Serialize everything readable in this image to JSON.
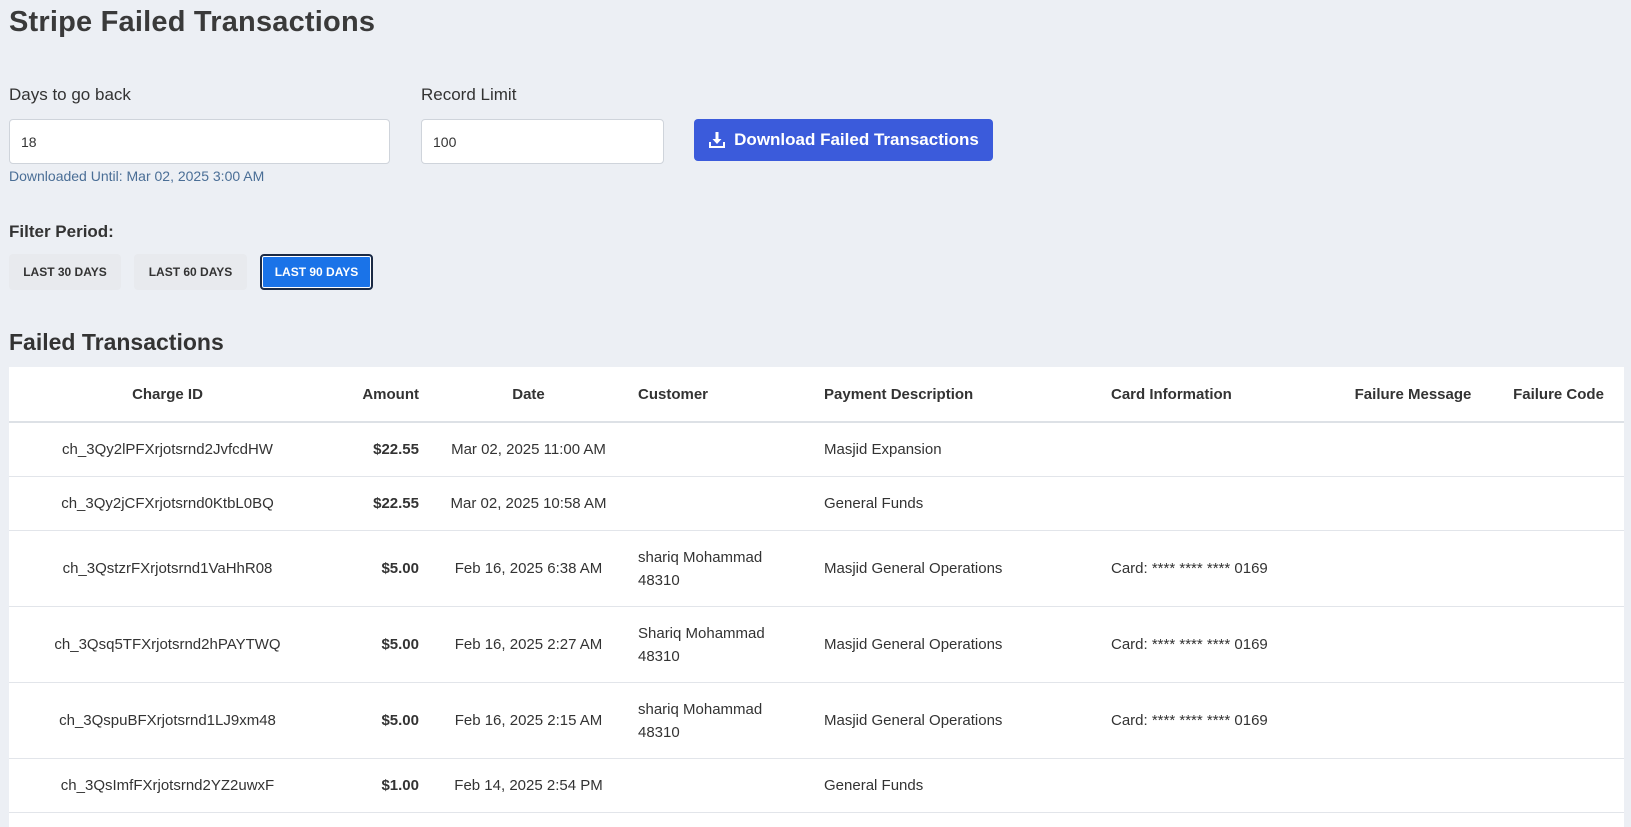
{
  "page": {
    "title": "Stripe Failed Transactions"
  },
  "form": {
    "days_label": "Days to go back",
    "days_value": "18",
    "limit_label": "Record Limit",
    "limit_value": "100",
    "downloaded_until": "Downloaded Until: Mar 02, 2025 3:00 AM",
    "download_button_label": "Download Failed Transactions",
    "download_icon": "download-icon"
  },
  "filter": {
    "label": "Filter Period:",
    "options": [
      "Last 30 Days",
      "Last 60 Days",
      "Last 90 Days"
    ],
    "selected": "Last 90 Days"
  },
  "table": {
    "title": "Failed Transactions",
    "columns": [
      "Charge ID",
      "Amount",
      "Date",
      "Customer",
      "Payment Description",
      "Card Information",
      "Failure Message",
      "Failure Code"
    ],
    "rows": [
      {
        "charge_id": "ch_3Qy2lPFXrjotsrnd2JvfcdHW",
        "amount": "$22.55",
        "date": "Mar 02, 2025 11:00 AM",
        "customer_name": "",
        "customer_zip": "",
        "description": "Masjid Expansion",
        "card": "",
        "failure_message": "",
        "failure_code": ""
      },
      {
        "charge_id": "ch_3Qy2jCFXrjotsrnd0KtbL0BQ",
        "amount": "$22.55",
        "date": "Mar 02, 2025 10:58 AM",
        "customer_name": "",
        "customer_zip": "",
        "description": "General Funds",
        "card": "",
        "failure_message": "",
        "failure_code": ""
      },
      {
        "charge_id": "ch_3QstzrFXrjotsrnd1VaHhR08",
        "amount": "$5.00",
        "date": "Feb 16, 2025 6:38 AM",
        "customer_name": "shariq Mohammad",
        "customer_zip": "48310",
        "description": "Masjid General Operations",
        "card": "Card: **** **** **** 0169",
        "failure_message": "",
        "failure_code": ""
      },
      {
        "charge_id": "ch_3Qsq5TFXrjotsrnd2hPAYTWQ",
        "amount": "$5.00",
        "date": "Feb 16, 2025 2:27 AM",
        "customer_name": "Shariq Mohammad",
        "customer_zip": "48310",
        "description": "Masjid General Operations",
        "card": "Card: **** **** **** 0169",
        "failure_message": "",
        "failure_code": ""
      },
      {
        "charge_id": "ch_3QspuBFXrjotsrnd1LJ9xm48",
        "amount": "$5.00",
        "date": "Feb 16, 2025 2:15 AM",
        "customer_name": "shariq Mohammad",
        "customer_zip": "48310",
        "description": "Masjid General Operations",
        "card": "Card: **** **** **** 0169",
        "failure_message": "",
        "failure_code": ""
      },
      {
        "charge_id": "ch_3QsImfFXrjotsrnd2YZ2uwxF",
        "amount": "$1.00",
        "date": "Feb 14, 2025 2:54 PM",
        "customer_name": "",
        "customer_zip": "",
        "description": "General Funds",
        "card": "",
        "failure_message": "",
        "failure_code": ""
      }
    ]
  },
  "colors": {
    "background": "#eceff4",
    "primary_button": "#3b5bdb",
    "active_filter": "#1a73e8",
    "helper_text": "#4a6e96"
  }
}
